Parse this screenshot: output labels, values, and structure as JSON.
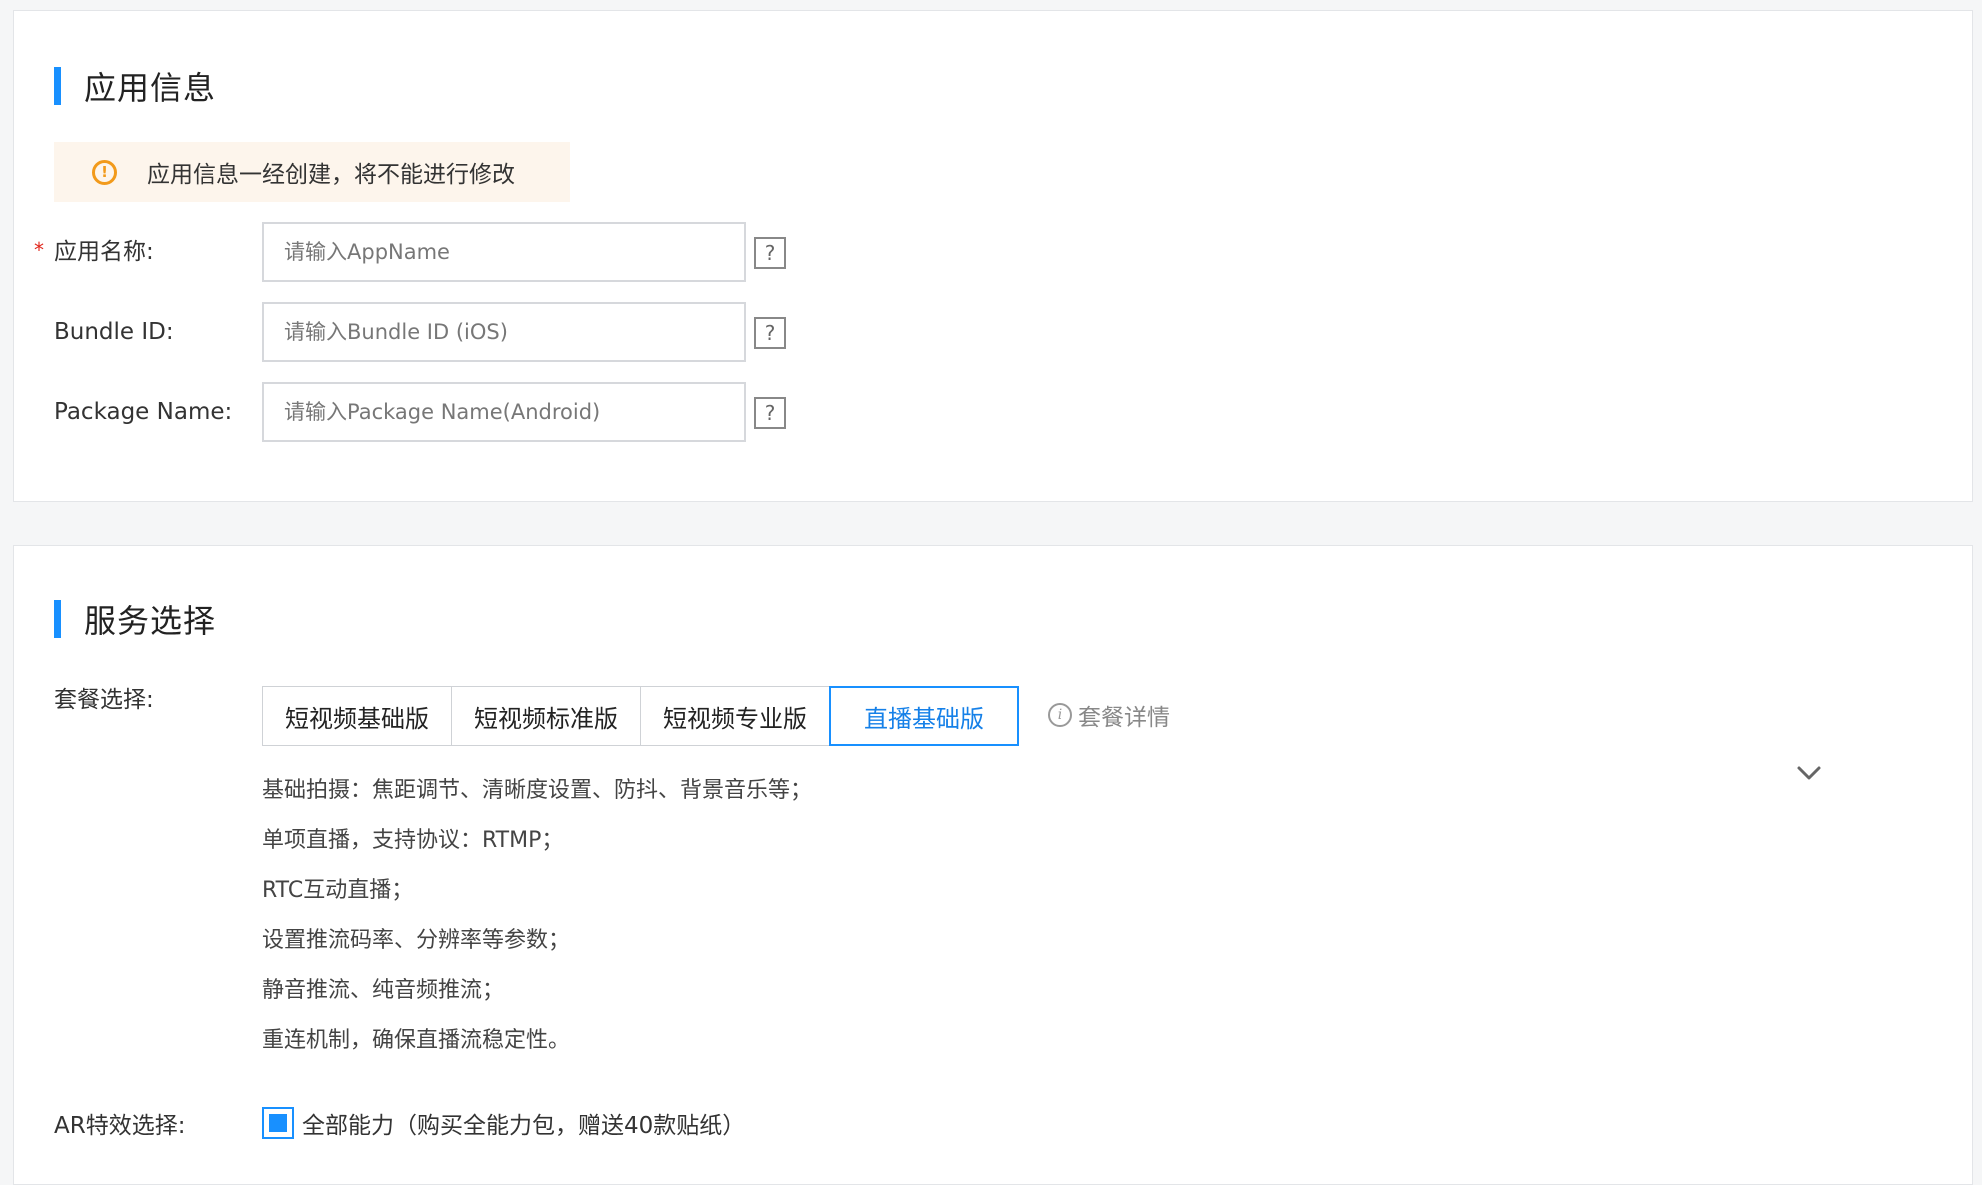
{
  "app_info": {
    "title": "应用信息",
    "notice": "应用信息一经创建，将不能进行修改",
    "notice_icon": "warning-circle-icon",
    "required_mark": "*",
    "help_mark": "?",
    "fields": [
      {
        "label": "应用名称:",
        "placeholder": "请输入AppName",
        "value": "",
        "required": true
      },
      {
        "label": "Bundle ID:",
        "placeholder": "请输入Bundle ID (iOS)",
        "value": "",
        "required": false
      },
      {
        "label": "Package Name:",
        "placeholder": "请输入Package Name(Android)",
        "value": "",
        "required": false
      }
    ]
  },
  "service": {
    "title": "服务选择",
    "package_label": "套餐选择:",
    "tabs": [
      {
        "label": "短视频基础版",
        "active": false
      },
      {
        "label": "短视频标准版",
        "active": false
      },
      {
        "label": "短视频专业版",
        "active": false
      },
      {
        "label": "直播基础版",
        "active": true
      }
    ],
    "package_detail_link": "套餐详情",
    "package_detail_icon_glyph": "i",
    "features": [
      "基础拍摄：焦距调节、清晰度设置、防抖、背景音乐等；",
      "单项直播，支持协议：RTMP；",
      "RTC互动直播；",
      "设置推流码率、分辨率等参数；",
      "静音推流、纯音频推流；",
      "重连机制，确保直播流稳定性。"
    ],
    "ar_label": "AR特效选择:",
    "ar_option": {
      "label": "全部能力（购买全能力包，赠送40款贴纸）",
      "checked": true
    }
  },
  "colors": {
    "accent": "#1890ff",
    "warning": "#f29a1b",
    "required": "#e1251b",
    "notice_bg": "#fdf5ec"
  }
}
